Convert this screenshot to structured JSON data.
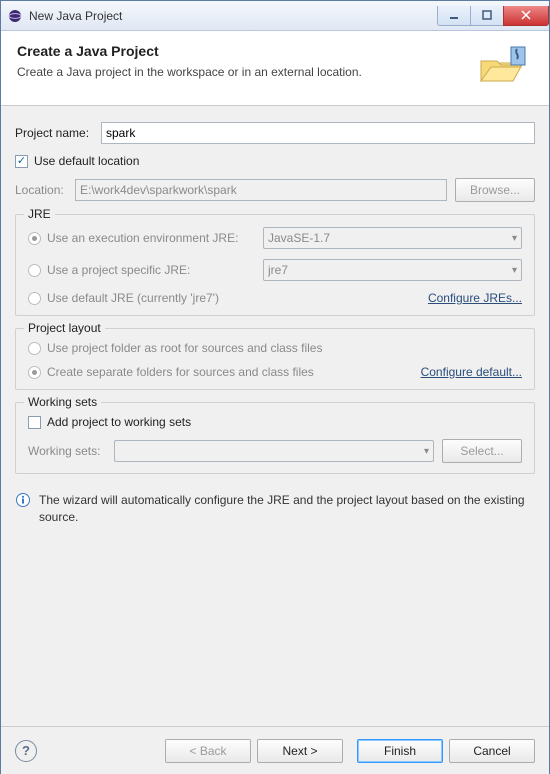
{
  "window": {
    "title": "New Java Project"
  },
  "header": {
    "title": "Create a Java Project",
    "subtitle": "Create a Java project in the workspace or in an external location."
  },
  "form": {
    "project_name_label": "Project name:",
    "project_name_value": "spark",
    "use_default_location_label": "Use default location",
    "use_default_location_checked": true,
    "location_label": "Location:",
    "location_value": "E:\\work4dev\\sparkwork\\spark",
    "browse_label": "Browse..."
  },
  "jre": {
    "legend": "JRE",
    "exec_env_label": "Use an execution environment JRE:",
    "exec_env_value": "JavaSE-1.7",
    "project_specific_label": "Use a project specific JRE:",
    "project_specific_value": "jre7",
    "default_jre_label": "Use default JRE (currently 'jre7')",
    "configure_link": "Configure JREs...",
    "selected": "exec_env"
  },
  "layout": {
    "legend": "Project layout",
    "root_folder_label": "Use project folder as root for sources and class files",
    "separate_folders_label": "Create separate folders for sources and class files",
    "configure_link": "Configure default...",
    "selected": "separate"
  },
  "working_sets": {
    "legend": "Working sets",
    "add_label": "Add project to working sets",
    "add_checked": false,
    "sets_label": "Working sets:",
    "sets_value": "",
    "select_label": "Select..."
  },
  "info": {
    "text": "The wizard will automatically configure the JRE and the project layout based on the existing source."
  },
  "footer": {
    "back": "< Back",
    "next": "Next >",
    "finish": "Finish",
    "cancel": "Cancel"
  }
}
